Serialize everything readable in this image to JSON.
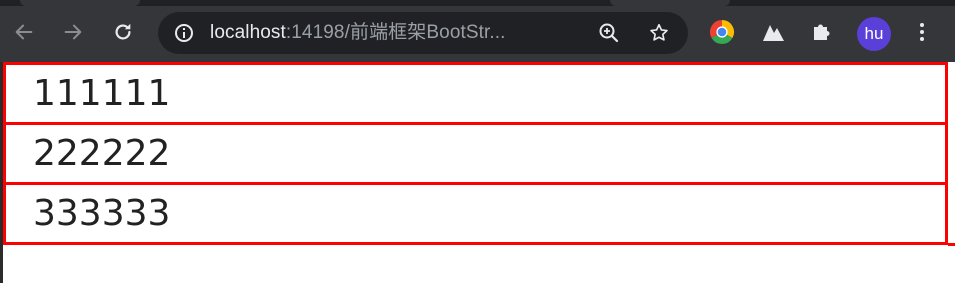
{
  "browser": {
    "url_host": "localhost",
    "url_path": ":14198/前端框架BootStr...",
    "profile_initials": "hu",
    "icons": {
      "back": "arrow-left-icon",
      "forward": "arrow-right-icon",
      "reload": "reload-icon",
      "site_info": "info-icon",
      "zoom": "zoom-in-icon",
      "bookmark": "star-icon",
      "extension_1": "chrome-logo-icon",
      "extension_2": "triangle-extension-icon",
      "extensions": "puzzle-icon",
      "menu": "kebab-menu-icon"
    },
    "colors": {
      "toolbar": "#35363a",
      "omnibox": "#202124",
      "avatar": "#5a3fd8"
    }
  },
  "page": {
    "rows": [
      {
        "text": "111111"
      },
      {
        "text": "222222"
      },
      {
        "text": "333333"
      }
    ],
    "colors": {
      "border": "#ff0000",
      "text": "#222222"
    }
  }
}
